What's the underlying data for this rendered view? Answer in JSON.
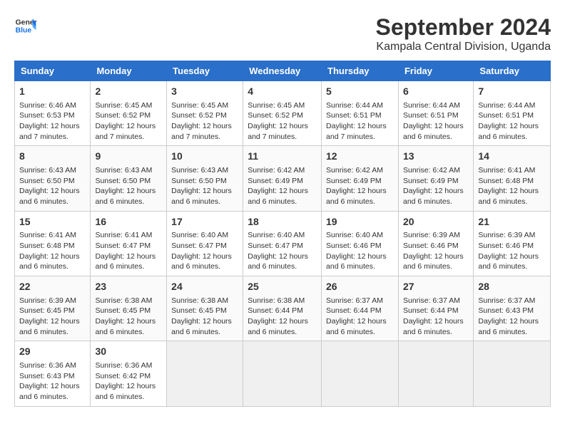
{
  "header": {
    "logo_line1": "General",
    "logo_line2": "Blue",
    "title": "September 2024",
    "subtitle": "Kampala Central Division, Uganda"
  },
  "weekdays": [
    "Sunday",
    "Monday",
    "Tuesday",
    "Wednesday",
    "Thursday",
    "Friday",
    "Saturday"
  ],
  "weeks": [
    [
      {
        "day": "1",
        "info": "Sunrise: 6:46 AM\nSunset: 6:53 PM\nDaylight: 12 hours\nand 7 minutes."
      },
      {
        "day": "2",
        "info": "Sunrise: 6:45 AM\nSunset: 6:52 PM\nDaylight: 12 hours\nand 7 minutes."
      },
      {
        "day": "3",
        "info": "Sunrise: 6:45 AM\nSunset: 6:52 PM\nDaylight: 12 hours\nand 7 minutes."
      },
      {
        "day": "4",
        "info": "Sunrise: 6:45 AM\nSunset: 6:52 PM\nDaylight: 12 hours\nand 7 minutes."
      },
      {
        "day": "5",
        "info": "Sunrise: 6:44 AM\nSunset: 6:51 PM\nDaylight: 12 hours\nand 7 minutes."
      },
      {
        "day": "6",
        "info": "Sunrise: 6:44 AM\nSunset: 6:51 PM\nDaylight: 12 hours\nand 6 minutes."
      },
      {
        "day": "7",
        "info": "Sunrise: 6:44 AM\nSunset: 6:51 PM\nDaylight: 12 hours\nand 6 minutes."
      }
    ],
    [
      {
        "day": "8",
        "info": "Sunrise: 6:43 AM\nSunset: 6:50 PM\nDaylight: 12 hours\nand 6 minutes."
      },
      {
        "day": "9",
        "info": "Sunrise: 6:43 AM\nSunset: 6:50 PM\nDaylight: 12 hours\nand 6 minutes."
      },
      {
        "day": "10",
        "info": "Sunrise: 6:43 AM\nSunset: 6:50 PM\nDaylight: 12 hours\nand 6 minutes."
      },
      {
        "day": "11",
        "info": "Sunrise: 6:42 AM\nSunset: 6:49 PM\nDaylight: 12 hours\nand 6 minutes."
      },
      {
        "day": "12",
        "info": "Sunrise: 6:42 AM\nSunset: 6:49 PM\nDaylight: 12 hours\nand 6 minutes."
      },
      {
        "day": "13",
        "info": "Sunrise: 6:42 AM\nSunset: 6:49 PM\nDaylight: 12 hours\nand 6 minutes."
      },
      {
        "day": "14",
        "info": "Sunrise: 6:41 AM\nSunset: 6:48 PM\nDaylight: 12 hours\nand 6 minutes."
      }
    ],
    [
      {
        "day": "15",
        "info": "Sunrise: 6:41 AM\nSunset: 6:48 PM\nDaylight: 12 hours\nand 6 minutes."
      },
      {
        "day": "16",
        "info": "Sunrise: 6:41 AM\nSunset: 6:47 PM\nDaylight: 12 hours\nand 6 minutes."
      },
      {
        "day": "17",
        "info": "Sunrise: 6:40 AM\nSunset: 6:47 PM\nDaylight: 12 hours\nand 6 minutes."
      },
      {
        "day": "18",
        "info": "Sunrise: 6:40 AM\nSunset: 6:47 PM\nDaylight: 12 hours\nand 6 minutes."
      },
      {
        "day": "19",
        "info": "Sunrise: 6:40 AM\nSunset: 6:46 PM\nDaylight: 12 hours\nand 6 minutes."
      },
      {
        "day": "20",
        "info": "Sunrise: 6:39 AM\nSunset: 6:46 PM\nDaylight: 12 hours\nand 6 minutes."
      },
      {
        "day": "21",
        "info": "Sunrise: 6:39 AM\nSunset: 6:46 PM\nDaylight: 12 hours\nand 6 minutes."
      }
    ],
    [
      {
        "day": "22",
        "info": "Sunrise: 6:39 AM\nSunset: 6:45 PM\nDaylight: 12 hours\nand 6 minutes."
      },
      {
        "day": "23",
        "info": "Sunrise: 6:38 AM\nSunset: 6:45 PM\nDaylight: 12 hours\nand 6 minutes."
      },
      {
        "day": "24",
        "info": "Sunrise: 6:38 AM\nSunset: 6:45 PM\nDaylight: 12 hours\nand 6 minutes."
      },
      {
        "day": "25",
        "info": "Sunrise: 6:38 AM\nSunset: 6:44 PM\nDaylight: 12 hours\nand 6 minutes."
      },
      {
        "day": "26",
        "info": "Sunrise: 6:37 AM\nSunset: 6:44 PM\nDaylight: 12 hours\nand 6 minutes."
      },
      {
        "day": "27",
        "info": "Sunrise: 6:37 AM\nSunset: 6:44 PM\nDaylight: 12 hours\nand 6 minutes."
      },
      {
        "day": "28",
        "info": "Sunrise: 6:37 AM\nSunset: 6:43 PM\nDaylight: 12 hours\nand 6 minutes."
      }
    ],
    [
      {
        "day": "29",
        "info": "Sunrise: 6:36 AM\nSunset: 6:43 PM\nDaylight: 12 hours\nand 6 minutes."
      },
      {
        "day": "30",
        "info": "Sunrise: 6:36 AM\nSunset: 6:42 PM\nDaylight: 12 hours\nand 6 minutes."
      },
      {
        "day": "",
        "info": ""
      },
      {
        "day": "",
        "info": ""
      },
      {
        "day": "",
        "info": ""
      },
      {
        "day": "",
        "info": ""
      },
      {
        "day": "",
        "info": ""
      }
    ]
  ]
}
